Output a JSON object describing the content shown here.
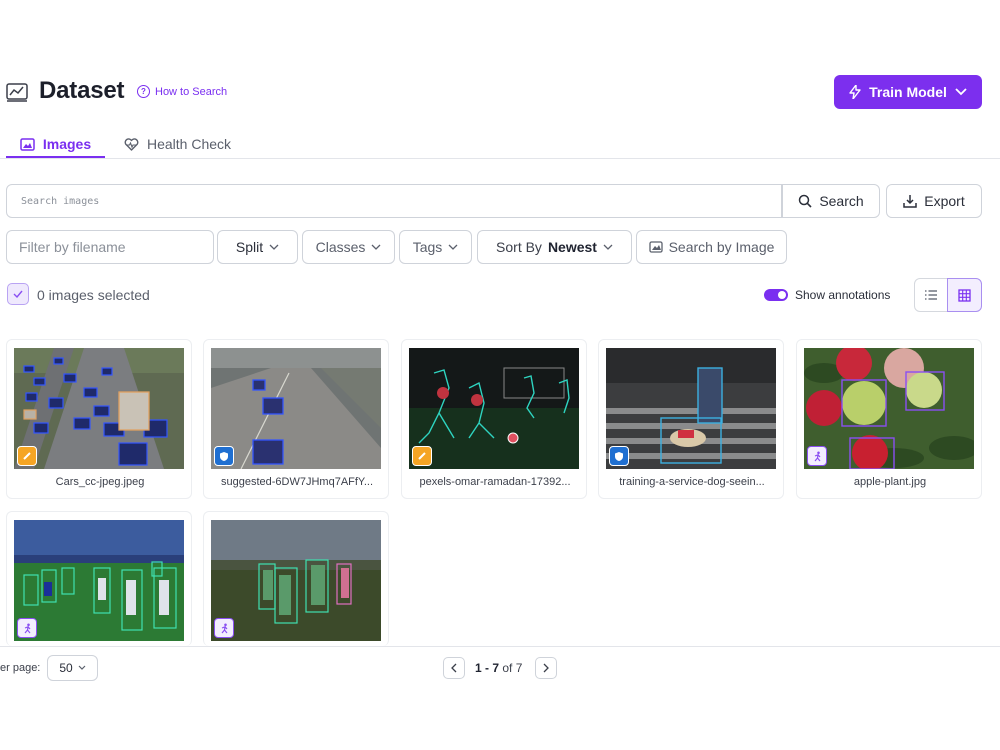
{
  "header": {
    "title": "Dataset",
    "how_to_search": "How to Search",
    "train_button": "Train Model"
  },
  "tabs": [
    {
      "label": "Images",
      "active": true,
      "icon": "image-icon"
    },
    {
      "label": "Health Check",
      "active": false,
      "icon": "heart-pulse-icon"
    }
  ],
  "search": {
    "placeholder": "Search images",
    "value": "",
    "search_button": "Search",
    "export_button": "Export"
  },
  "filters": {
    "filename_placeholder": "Filter by filename",
    "split": "Split",
    "classes": "Classes",
    "tags": "Tags",
    "sort_prefix": "Sort By",
    "sort_value": "Newest",
    "search_by_image": "Search by Image"
  },
  "selection": {
    "label": "0 images selected",
    "show_annotations_label": "Show annotations",
    "show_annotations": true,
    "view_mode": "grid"
  },
  "images": [
    {
      "filename": "Cars_cc-jpeg.jpeg",
      "badge": "pencil-icon",
      "badge_color": "#f5a524"
    },
    {
      "filename": "suggested-6DW7JHmq7AFfY...",
      "badge": "shield-icon",
      "badge_color": "#1f6fd1"
    },
    {
      "filename": "pexels-omar-ramadan-17392...",
      "badge": "pencil-icon",
      "badge_color": "#f5a524"
    },
    {
      "filename": "training-a-service-dog-seein...",
      "badge": "shield-icon",
      "badge_color": "#1f6fd1"
    },
    {
      "filename": "apple-plant.jpg",
      "badge": "person-running-icon",
      "badge_color": "#8a4ff2"
    },
    {
      "filename": "",
      "badge": "person-running-icon",
      "badge_color": "#8a4ff2"
    },
    {
      "filename": "",
      "badge": "person-running-icon",
      "badge_color": "#8a4ff2"
    }
  ],
  "pagination": {
    "per_page_label": "er page:",
    "per_page_value": "50",
    "range": "1 - 7",
    "of_label": "of",
    "total": "7"
  },
  "colors": {
    "accent": "#7a2ff0",
    "train_button": "#7c2fee"
  }
}
